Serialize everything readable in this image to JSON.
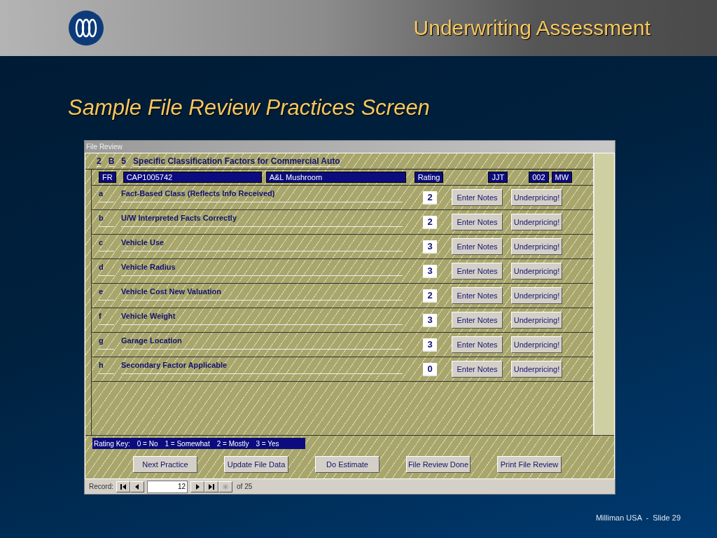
{
  "slide": {
    "heading": "Underwriting Assessment",
    "subtitle": "Sample File Review Practices Screen",
    "footer": "Milliman USA  -  Slide 29"
  },
  "window": {
    "title": "File Review",
    "section": [
      "2",
      "B",
      "5"
    ],
    "section_title": "Specific Classification Factors for Commercial Auto",
    "info": {
      "type": "FR",
      "file_number": "CAP1005742",
      "insured": "A&L Mushroom",
      "rating_label": "Rating",
      "reviewer": "JJT",
      "office": "002",
      "region": "MW"
    },
    "factors": [
      {
        "letter": "a",
        "label": "Fact-Based Class (Reflects Info Received)",
        "rating": "2",
        "buttons": [
          "Enter Notes",
          "Underpricing!"
        ]
      },
      {
        "letter": "b",
        "label": "U/W Interpreted Facts Correctly",
        "rating": "2",
        "buttons": [
          "Enter Notes",
          "Underpricing!"
        ]
      },
      {
        "letter": "c",
        "label": "Vehicle Use",
        "rating": "3",
        "buttons": [
          "Enter Notes",
          "Underpricing!"
        ]
      },
      {
        "letter": "d",
        "label": "Vehicle Radius",
        "rating": "3",
        "buttons": [
          "Enter Notes",
          "Underpricing!"
        ]
      },
      {
        "letter": "e",
        "label": "Vehicle Cost New Valuation",
        "rating": "2",
        "buttons": [
          "Enter Notes",
          "Underpricing!"
        ]
      },
      {
        "letter": "f",
        "label": "Vehicle Weight",
        "rating": "3",
        "buttons": [
          "Enter Notes",
          "Underpricing!"
        ]
      },
      {
        "letter": "g",
        "label": "Garage Location",
        "rating": "3",
        "buttons": [
          "Enter Notes",
          "Underpricing!"
        ]
      },
      {
        "letter": "h",
        "label": "Secondary Factor Applicable",
        "rating": "0",
        "buttons": [
          "Enter Notes",
          "Underpricing!"
        ]
      }
    ],
    "rating_key": [
      "Rating Key:",
      "0 = No",
      "1 = Somewhat",
      "2 = Mostly",
      "3 = Yes"
    ],
    "actions": [
      "Next Practice",
      "Update File Data",
      "Do Estimate",
      "File Review Done",
      "Print File Review"
    ],
    "record": {
      "label": "Record:",
      "value": "12",
      "total": "of 25"
    }
  }
}
